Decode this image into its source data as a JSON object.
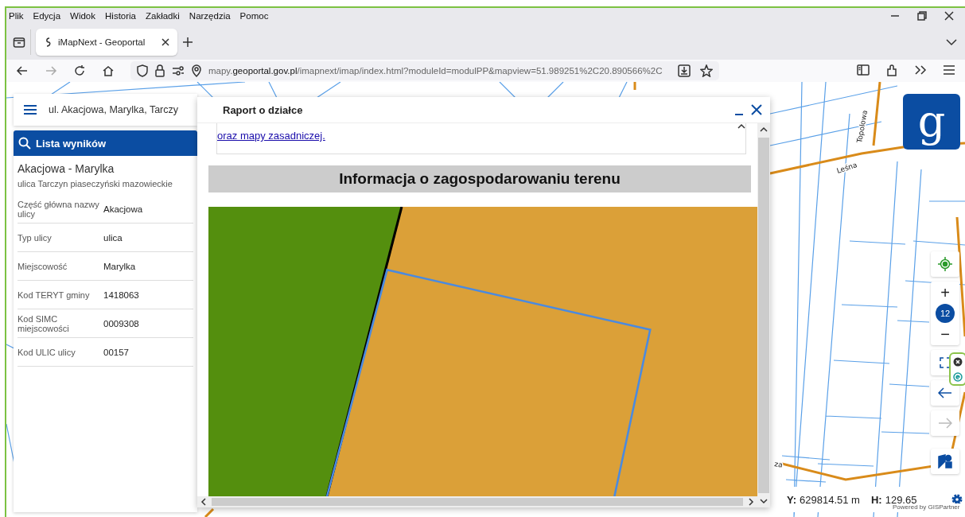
{
  "menu": [
    "Plik",
    "Edycja",
    "Widok",
    "Historia",
    "Zakładki",
    "Narzędzia",
    "Pomoc"
  ],
  "tabs": [
    {
      "title": "iMapNext - Geoportal",
      "selected": true
    }
  ],
  "nav": [
    {
      "kind": "back",
      "disabled": false
    },
    {
      "kind": "forward",
      "disabled": true
    },
    {
      "kind": "reload",
      "disabled": false
    },
    {
      "kind": "home",
      "disabled": false
    }
  ],
  "address": {
    "prefix": "mapy.",
    "domain": "geoportal.gov.pl",
    "path": "/imapnext/imap/index.html?moduleId=modulPP&mapview=51.989251%2C20.890566%2C"
  },
  "search": {
    "value": "ul. Akacjowa, Marylka, Tarczy"
  },
  "results": {
    "title": "Lista wyników",
    "name": "Akacjowa - Marylka",
    "subtitle": "ulica Tarczyn piaseczyński mazowieckie",
    "rows": [
      {
        "label": "Część główna nazwy ulicy",
        "value": "Akacjowa"
      },
      {
        "label": "Typ ulicy",
        "value": "ulica"
      },
      {
        "label": "Miejscowość",
        "value": "Marylka"
      },
      {
        "label": "Kod TERYT gminy",
        "value": "1418063"
      },
      {
        "label": "Kod SIMC miejscowości",
        "value": "0009308"
      },
      {
        "label": "Kod ULIC ulicy",
        "value": "00157"
      }
    ]
  },
  "dialog": {
    "title": "Raport o działce",
    "link": "oraz mapy zasadniczej.",
    "section_title": "Informacja o zagospodarowaniu terenu"
  },
  "map": {
    "labels": [
      "Topolowa",
      "Leśna",
      "za"
    ],
    "logo_text": "g",
    "zoom_in": "+",
    "zoom_level": "12",
    "zoom_out": "−",
    "controls": [
      {
        "kind": "locate",
        "disabled": false
      },
      {
        "kind": "zoom",
        "disabled": false
      },
      {
        "kind": "fullscreen",
        "disabled": false
      },
      {
        "kind": "back",
        "disabled": false
      },
      {
        "kind": "forward",
        "disabled": true
      },
      {
        "kind": "layers",
        "disabled": false
      }
    ],
    "coordinates": [
      {
        "axis": "Y:",
        "value": "629814.51 m"
      },
      {
        "axis": "H:",
        "value": "129.65"
      }
    ],
    "attribution": "Powered by GISPartner"
  }
}
